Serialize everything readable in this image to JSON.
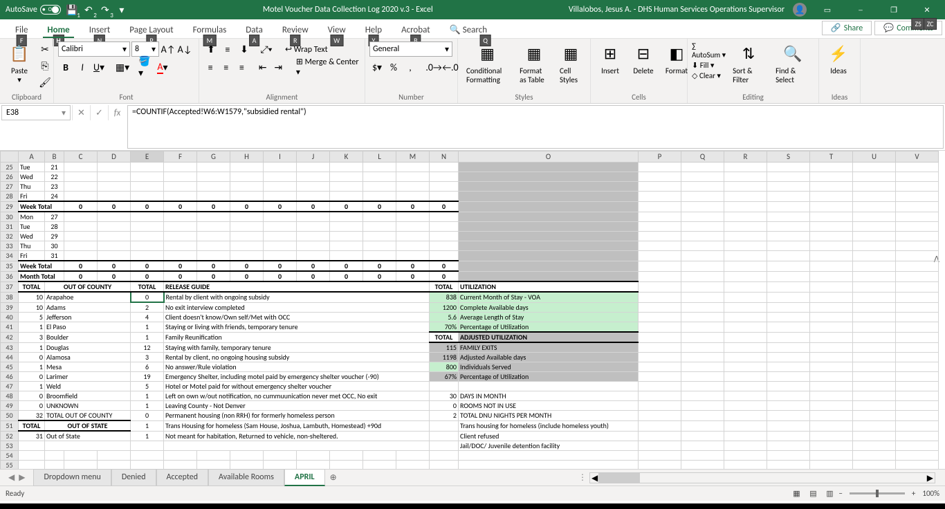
{
  "title": {
    "autosave": "AutoSave",
    "toggle": "Off",
    "doc": "Motel Voucher Data Collection Log 2020 v.3  -  Excel",
    "user": "Villalobos, Jesus A. - DHS Human Services Operations Supervisor"
  },
  "qat_badges": [
    "1",
    "2",
    "3"
  ],
  "tabs": {
    "file": "File",
    "home": "Home",
    "insert": "Insert",
    "page": "Page Layout",
    "formulas": "Formulas",
    "data": "Data",
    "review": "Review",
    "view": "View",
    "help": "Help",
    "acrobat": "Acrobat",
    "search": "Search"
  },
  "tab_keytips": {
    "file": "F",
    "home": "H",
    "insert": "N",
    "page": "P",
    "formulas": "M",
    "data": "A",
    "review": "R",
    "view": "W",
    "help": "Y",
    "acrobat": "B",
    "search": "Q"
  },
  "ribbon_right": {
    "share": "Share",
    "share_tip": "ZS",
    "comments": "Comments",
    "comments_tip": "ZC"
  },
  "ribbon": {
    "clipboard": "Clipboard",
    "paste": "Paste",
    "font_group": "Font",
    "font": "Calibri",
    "size": "8",
    "alignment": "Alignment",
    "wrap": "Wrap Text",
    "merge": "Merge & Center",
    "number_group": "Number",
    "number_format": "General",
    "styles": "Styles",
    "cond": "Conditional Formatting",
    "fmt_table": "Format as Table",
    "cell_styles": "Cell Styles",
    "cells": "Cells",
    "insert": "Insert",
    "delete": "Delete",
    "format": "Format",
    "editing": "Editing",
    "autosum": "AutoSum",
    "fill": "Fill",
    "clear": "Clear",
    "sort": "Sort & Filter",
    "find": "Find & Select",
    "ideas_group": "Ideas",
    "ideas": "Ideas"
  },
  "namebox": "E38",
  "formula": "=COUNTIF(Accepted!W6:W1579,\"subsidied rental\")",
  "cols": [
    "A",
    "B",
    "C",
    "D",
    "E",
    "F",
    "G",
    "H",
    "I",
    "J",
    "K",
    "L",
    "M",
    "N",
    "O",
    "P",
    "Q",
    "R",
    "S",
    "T",
    "U",
    "V"
  ],
  "widths": [
    38,
    28,
    48,
    48,
    48,
    48,
    48,
    48,
    48,
    48,
    48,
    48,
    48,
    42,
    260,
    62,
    62,
    62,
    62,
    62,
    62,
    62
  ],
  "rows": [
    {
      "n": 25,
      "cells": [
        "Tue",
        "21"
      ]
    },
    {
      "n": 26,
      "cells": [
        "Wed",
        "22"
      ]
    },
    {
      "n": 27,
      "cells": [
        "Thu",
        "23"
      ]
    },
    {
      "n": 28,
      "cells": [
        "Fri",
        "24"
      ]
    },
    {
      "n": 29,
      "cells": [
        "Week Total",
        "",
        "0",
        "0",
        "0",
        "0",
        "0",
        "0",
        "0",
        "0",
        "0",
        "0",
        "0",
        "0"
      ],
      "bold": true,
      "thick": true,
      "merge01": true
    },
    {
      "n": 30,
      "cells": [
        "Mon",
        "27"
      ]
    },
    {
      "n": 31,
      "cells": [
        "Tue",
        "28"
      ]
    },
    {
      "n": 32,
      "cells": [
        "Wed",
        "29"
      ]
    },
    {
      "n": 33,
      "cells": [
        "Thu",
        "30"
      ]
    },
    {
      "n": 34,
      "cells": [
        "Fri",
        "31"
      ]
    },
    {
      "n": 35,
      "cells": [
        "Week Total",
        "",
        "0",
        "0",
        "0",
        "0",
        "0",
        "0",
        "0",
        "0",
        "0",
        "0",
        "0",
        "0"
      ],
      "bold": true,
      "thick": true,
      "merge01": true
    },
    {
      "n": 36,
      "cells": [
        "Month Total",
        "",
        "0",
        "0",
        "0",
        "0",
        "0",
        "0",
        "0",
        "0",
        "0",
        "0",
        "0",
        "0"
      ],
      "bold": true,
      "thick": true,
      "merge01": true
    }
  ],
  "summary": {
    "r37": {
      "a": "TOTAL",
      "bde": "OUT OF COUNTY",
      "e": "TOTAL",
      "f": "RELEASE GUIDE",
      "n": "TOTAL",
      "o": "UTILIZATION"
    },
    "county_rows": [
      {
        "n": 38,
        "a": "10",
        "b": "Arapahoe",
        "e": "0",
        "f": "Rental by client with ongoing subsidy",
        "nval": "838",
        "o": "Current Month of Stay - VOA",
        "ocolor": "green"
      },
      {
        "n": 39,
        "a": "10",
        "b": "Adams",
        "e": "2",
        "f": "No exit interview completed",
        "nval": "1200",
        "o": "Complete Available days",
        "ocolor": "green"
      },
      {
        "n": 40,
        "a": "5",
        "b": "Jefferson",
        "e": "4",
        "f": "Client doesn't know/Own self/Met with OCC",
        "nval": "5.6",
        "o": "Average Length of Stay",
        "ocolor": "green"
      },
      {
        "n": 41,
        "a": "1",
        "b": "El Paso",
        "e": "1",
        "f": "Staying or living with friends, temporary tenure",
        "nval": "70%",
        "o": "Percentage of Utilization",
        "ocolor": "green"
      },
      {
        "n": 42,
        "a": "3",
        "b": "Boulder",
        "e": "1",
        "f": "Family Reunification",
        "nlab": "TOTAL",
        "o": "ADJUSTED UTILIZATION",
        "ohead": true
      },
      {
        "n": 43,
        "a": "1",
        "b": "Douglas",
        "e": "12",
        "f": "Staying with family, temporary tenure",
        "nval": "115",
        "o": "FAMILY EXITS",
        "gray": true
      },
      {
        "n": 44,
        "a": "0",
        "b": "Alamosa",
        "e": "3",
        "f": "Rental by client, no ongoing housing subsidy",
        "nval": "1198",
        "o": "Adjusted Available days",
        "gray": true
      },
      {
        "n": 45,
        "a": "1",
        "b": "Mesa",
        "e": "6",
        "f": "No answer/Rule violation",
        "nval": "800",
        "o": "Individuals Served",
        "gray": true,
        "nvgreen": true
      },
      {
        "n": 46,
        "a": "0",
        "b": "Larimer",
        "e": "19",
        "f": "Emergency Shelter, including motel paid by emergency shelter voucher (-90)",
        "nval": "67%",
        "o": "Percentage of Utilization",
        "gray": true
      },
      {
        "n": 47,
        "a": "1",
        "b": "Weld",
        "e": "5",
        "f": "Hotel or Motel paid for without emergency shelter voucher"
      },
      {
        "n": 48,
        "a": "0",
        "b": "Broomfield",
        "e": "1",
        "f": "Left on own w/out notification, no cummuunication never met OCC, No exit",
        "nval": "30",
        "o": "DAYS IN MONTH"
      },
      {
        "n": 49,
        "a": "0",
        "b": "UNKNOWN",
        "e": "1",
        "f": "Leaving County - Not Denver",
        "nval": "0",
        "o": "ROOMS NOT IN USE"
      },
      {
        "n": 50,
        "a": "32",
        "b": "TOTAL OUT OF COUNTY",
        "e": "0",
        "f": "Permanent housing (non RRH) for formerly homeless person",
        "nval": "2",
        "o": "TOTAL DNU NIGHTS PER MONTH"
      },
      {
        "n": 51,
        "ahead": "TOTAL",
        "bhead": "OUT OF STATE",
        "e": "1",
        "f": "Trans Housing for homeless (Sam House, Joshua, Lambuth, Homestead) +90d",
        "o": "Trans housing for homeless (include homeless youth)"
      },
      {
        "n": 52,
        "a": "31",
        "b": "Out of State",
        "e": "1",
        "f": "Not meant for habitation, Returned to vehicle, non-sheltered.",
        "o": "Client refused"
      },
      {
        "n": 53,
        "o": "Jail/DOC/ Juvenile detention facility"
      }
    ]
  },
  "sheets": [
    "Dropdown menu",
    "Denied",
    "Accepted",
    "Available Rooms",
    "APRIL"
  ],
  "active_sheet": 4,
  "status": {
    "ready": "Ready",
    "zoom": "100%"
  }
}
